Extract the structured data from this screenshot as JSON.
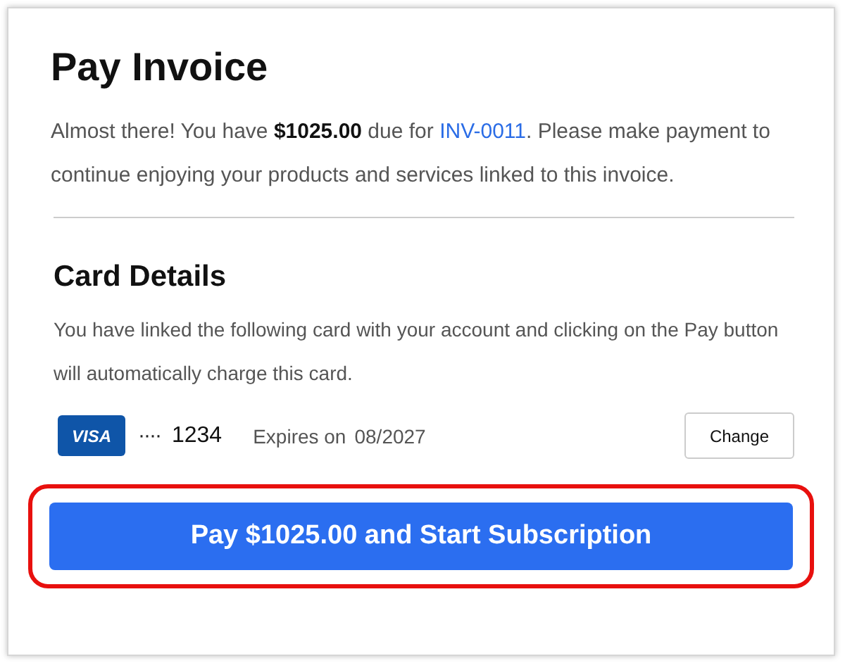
{
  "title": "Pay Invoice",
  "intro": {
    "before": "Almost there! You have **$1025.00** due for ",
    "link": "INV-0011",
    "after": ". Please make payment to continue enjoying your products and services linked to this invoice."
  },
  "card_section": {
    "heading": "Card Details",
    "description": "You have linked the following card with your account and clicking on the Pay button will automatically charge this card.",
    "card": {
      "brand": "VISA",
      "mask": "····",
      "last4": "1234",
      "expiry_label": "Expires on",
      "expiry": "08/2027"
    },
    "change_button": "Change"
  },
  "pay_button": {
    "label": "Pay $1025.00 and Start Subscription",
    "highlighted": true
  }
}
